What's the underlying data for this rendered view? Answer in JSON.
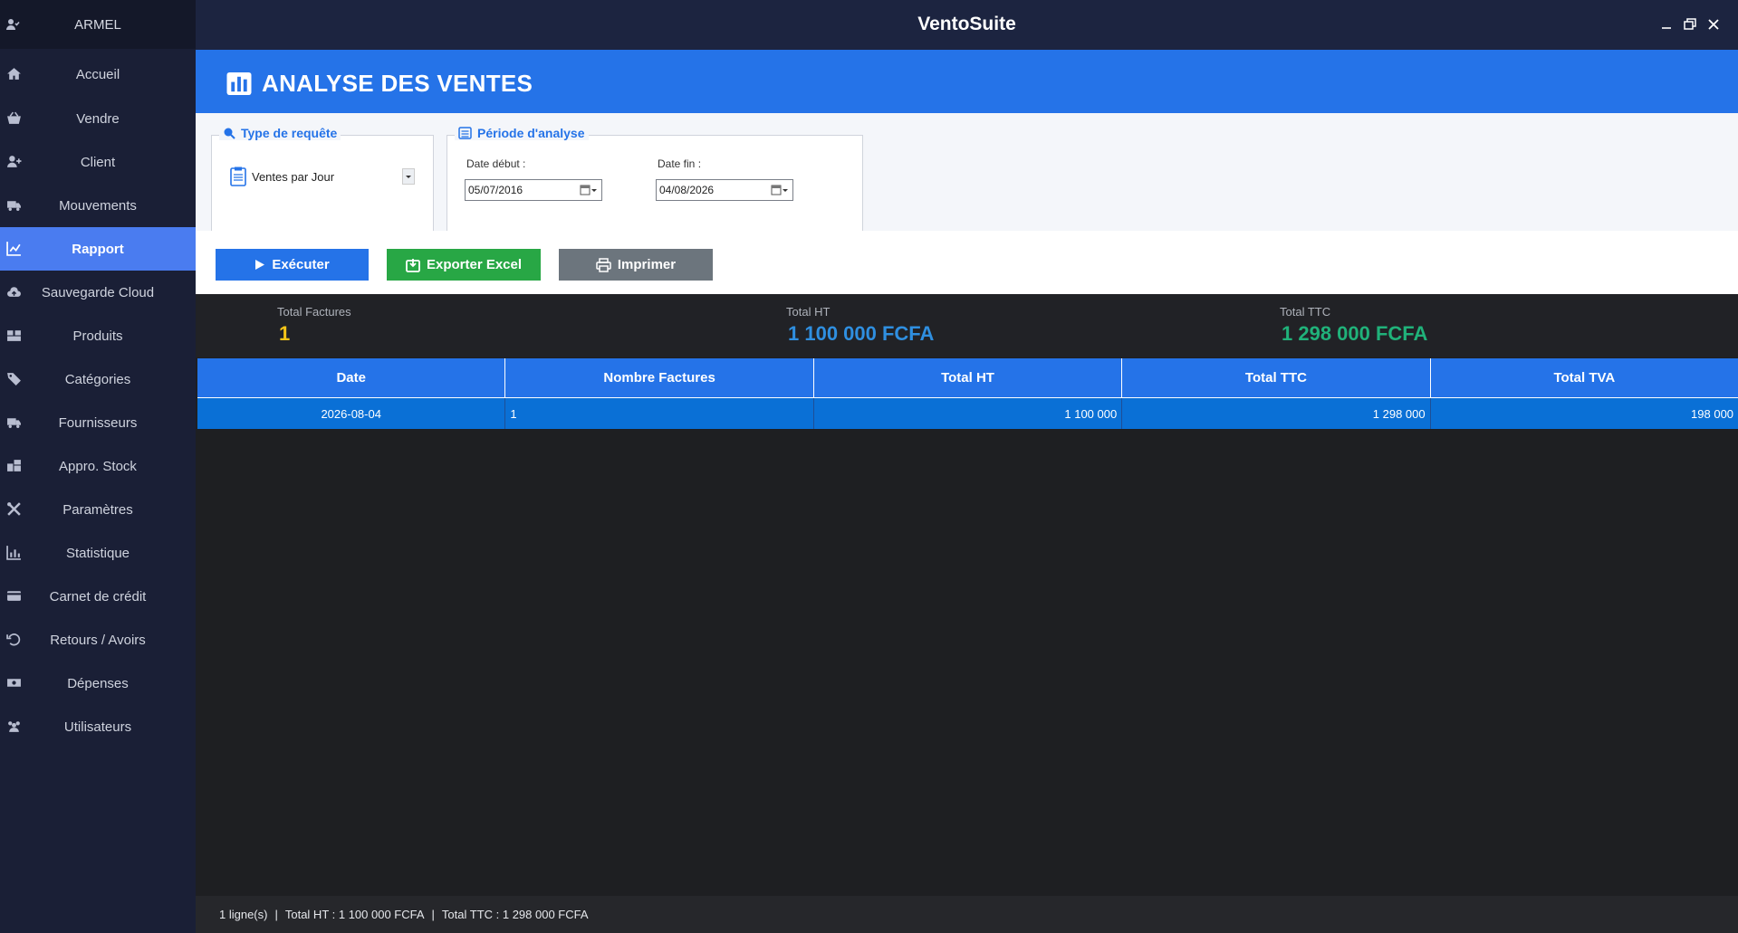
{
  "app": {
    "title": "VentoSuite"
  },
  "sidebar": {
    "user": "ARMEL",
    "items": [
      {
        "label": "Accueil",
        "icon": "home-icon"
      },
      {
        "label": "Vendre",
        "icon": "basket-icon"
      },
      {
        "label": "Client",
        "icon": "user-plus-icon"
      },
      {
        "label": "Mouvements",
        "icon": "truck-icon"
      },
      {
        "label": "Rapport",
        "icon": "chart-line-icon",
        "active": true
      },
      {
        "label": "Sauvegarde Cloud",
        "icon": "cloud-upload-icon"
      },
      {
        "label": "Produits",
        "icon": "boxes-icon"
      },
      {
        "label": "Catégories",
        "icon": "tags-icon"
      },
      {
        "label": "Fournisseurs",
        "icon": "truck-icon"
      },
      {
        "label": "Appro. Stock",
        "icon": "warehouse-icon"
      },
      {
        "label": "Paramètres",
        "icon": "tools-icon"
      },
      {
        "label": "Statistique",
        "icon": "bar-chart-icon"
      },
      {
        "label": "Carnet de crédit",
        "icon": "wallet-icon"
      },
      {
        "label": "Retours / Avoirs",
        "icon": "undo-icon"
      },
      {
        "label": "Dépenses",
        "icon": "money-icon"
      },
      {
        "label": "Utilisateurs",
        "icon": "users-icon"
      }
    ]
  },
  "header": {
    "title": "ANALYSE DES VENTES"
  },
  "filters": {
    "request_group_title": "Type de requête",
    "request_type": "Ventes par Jour",
    "period_group_title": "Période d'analyse",
    "start_label": "Date début :",
    "start_value": "05/07/2016",
    "end_label": "Date fin :",
    "end_value": "04/08/2026"
  },
  "actions": {
    "execute": "Exécuter",
    "export": "Exporter Excel",
    "print": "Imprimer"
  },
  "totals": {
    "invoices_label": "Total Factures",
    "invoices_value": "1",
    "ht_label": "Total HT",
    "ht_value": "1 100 000 FCFA",
    "ttc_label": "Total TTC",
    "ttc_value": "1 298 000 FCFA"
  },
  "table": {
    "columns": [
      "Date",
      "Nombre Factures",
      "Total HT",
      "Total TTC",
      "Total TVA"
    ],
    "rows": [
      [
        "2026-08-04",
        "1",
        "1 100 000",
        "1 298 000",
        "198 000"
      ]
    ]
  },
  "status": {
    "rows": "1 ligne(s)",
    "sep": "|",
    "ht": "Total HT : 1 100 000 FCFA",
    "ttc": "Total TTC : 1 298 000 FCFA"
  },
  "colors": {
    "accent": "#2573E8",
    "sidebar_bg": "#1A1F36",
    "active_nav": "#4A7CF0",
    "export_green": "#28A745",
    "print_gray": "#6C757D",
    "invoices_yellow": "#F5C518",
    "ht_blue": "#2F8FE0",
    "ttc_teal": "#20B27A"
  }
}
